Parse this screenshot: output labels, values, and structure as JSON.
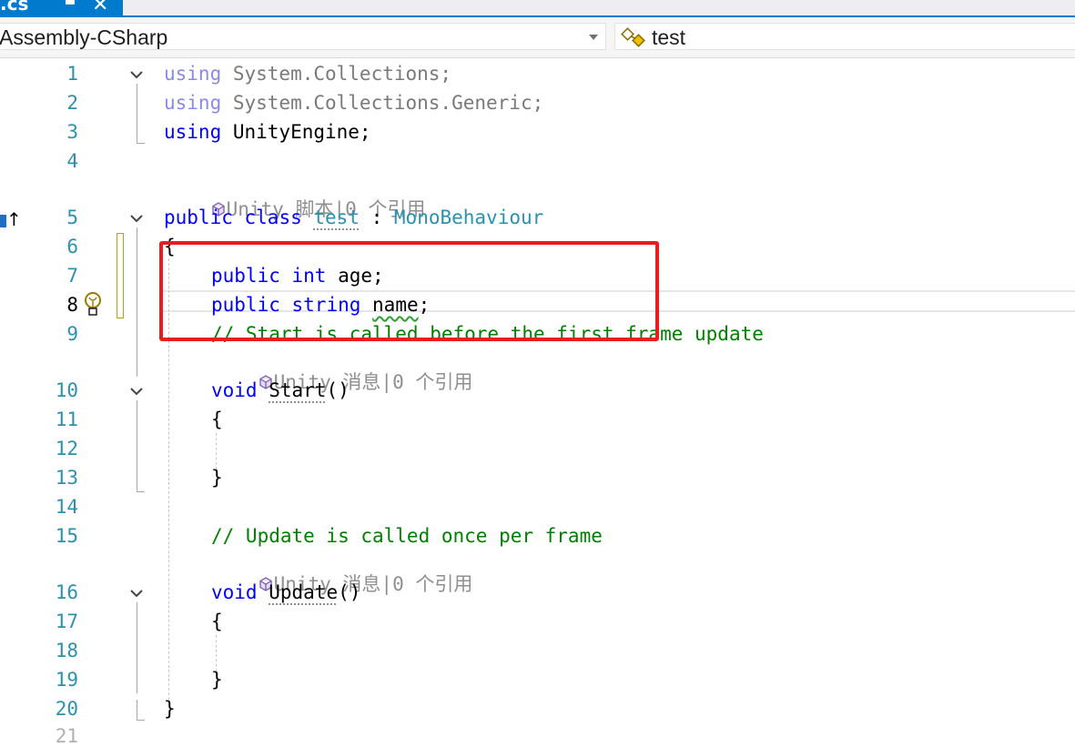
{
  "tab": {
    "label": ".cs",
    "pin": "▀",
    "close": "✕"
  },
  "nav": {
    "project": "Assembly-CSharp",
    "class": "test"
  },
  "lens": {
    "class": "Unity 脚本|0 个引用",
    "start": "Unity 消息|0 个引用",
    "update": "Unity 消息|0 个引用"
  },
  "lines": {
    "n1": "1",
    "n2": "2",
    "n3": "3",
    "n4": "4",
    "n5": "5",
    "n6": "6",
    "n7": "7",
    "n8": "8",
    "n9": "9",
    "n10": "10",
    "n11": "11",
    "n12": "12",
    "n13": "13",
    "n14": "14",
    "n15": "15",
    "n16": "16",
    "n17": "17",
    "n18": "18",
    "n19": "19",
    "n20": "20",
    "n21": "21"
  },
  "code": {
    "using_kw": "using",
    "l1_ns": " System.Collections;",
    "l2_ns": " System.Collections.Generic;",
    "l3_ns": " UnityEngine;",
    "public_kw": "public",
    "class_kw": "class",
    "class_name": "test",
    "colon": " : ",
    "base_class": "MonoBehaviour",
    "open_brace": "{",
    "close_brace": "}",
    "int_kw": "int",
    "age": " age;",
    "string_kw": "string",
    "name_field": "name",
    "semicolon": ";",
    "comment_start": "// Start is called before the first frame update",
    "void_kw": "void",
    "start_name": "Start",
    "parens": "()",
    "comment_update": "// Update is called once per frame",
    "update_name": "Update"
  },
  "colors": {
    "keyword": "#0000ff",
    "type": "#2b91af",
    "comment": "#008000",
    "line_number": "#2b91af",
    "tab_active": "#007acc",
    "highlight_box": "#e81e1e"
  },
  "icons": {
    "lightbulb": "lightbulb-icon",
    "unity_cube": "unity-cube-icon",
    "class": "class-icon",
    "fold": "chevron-down-icon"
  }
}
